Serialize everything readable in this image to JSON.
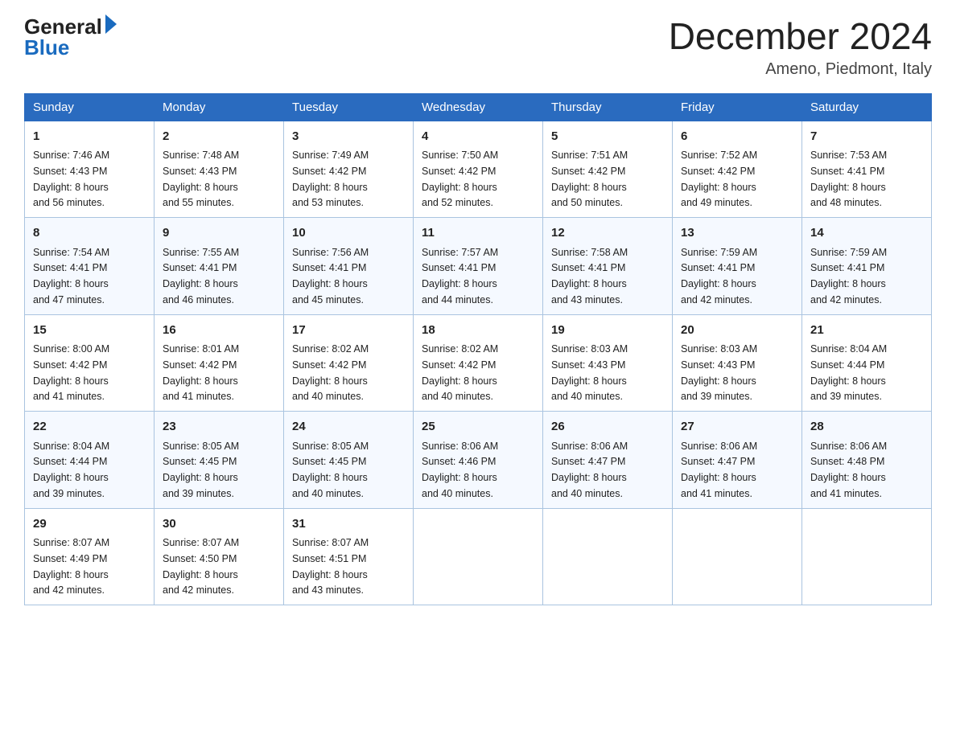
{
  "header": {
    "logo_general": "General",
    "logo_blue": "Blue",
    "month_year": "December 2024",
    "location": "Ameno, Piedmont, Italy"
  },
  "days_of_week": [
    "Sunday",
    "Monday",
    "Tuesday",
    "Wednesday",
    "Thursday",
    "Friday",
    "Saturday"
  ],
  "weeks": [
    [
      {
        "day": "1",
        "sunrise": "7:46 AM",
        "sunset": "4:43 PM",
        "daylight": "8 hours and 56 minutes."
      },
      {
        "day": "2",
        "sunrise": "7:48 AM",
        "sunset": "4:43 PM",
        "daylight": "8 hours and 55 minutes."
      },
      {
        "day": "3",
        "sunrise": "7:49 AM",
        "sunset": "4:42 PM",
        "daylight": "8 hours and 53 minutes."
      },
      {
        "day": "4",
        "sunrise": "7:50 AM",
        "sunset": "4:42 PM",
        "daylight": "8 hours and 52 minutes."
      },
      {
        "day": "5",
        "sunrise": "7:51 AM",
        "sunset": "4:42 PM",
        "daylight": "8 hours and 50 minutes."
      },
      {
        "day": "6",
        "sunrise": "7:52 AM",
        "sunset": "4:42 PM",
        "daylight": "8 hours and 49 minutes."
      },
      {
        "day": "7",
        "sunrise": "7:53 AM",
        "sunset": "4:41 PM",
        "daylight": "8 hours and 48 minutes."
      }
    ],
    [
      {
        "day": "8",
        "sunrise": "7:54 AM",
        "sunset": "4:41 PM",
        "daylight": "8 hours and 47 minutes."
      },
      {
        "day": "9",
        "sunrise": "7:55 AM",
        "sunset": "4:41 PM",
        "daylight": "8 hours and 46 minutes."
      },
      {
        "day": "10",
        "sunrise": "7:56 AM",
        "sunset": "4:41 PM",
        "daylight": "8 hours and 45 minutes."
      },
      {
        "day": "11",
        "sunrise": "7:57 AM",
        "sunset": "4:41 PM",
        "daylight": "8 hours and 44 minutes."
      },
      {
        "day": "12",
        "sunrise": "7:58 AM",
        "sunset": "4:41 PM",
        "daylight": "8 hours and 43 minutes."
      },
      {
        "day": "13",
        "sunrise": "7:59 AM",
        "sunset": "4:41 PM",
        "daylight": "8 hours and 42 minutes."
      },
      {
        "day": "14",
        "sunrise": "7:59 AM",
        "sunset": "4:41 PM",
        "daylight": "8 hours and 42 minutes."
      }
    ],
    [
      {
        "day": "15",
        "sunrise": "8:00 AM",
        "sunset": "4:42 PM",
        "daylight": "8 hours and 41 minutes."
      },
      {
        "day": "16",
        "sunrise": "8:01 AM",
        "sunset": "4:42 PM",
        "daylight": "8 hours and 41 minutes."
      },
      {
        "day": "17",
        "sunrise": "8:02 AM",
        "sunset": "4:42 PM",
        "daylight": "8 hours and 40 minutes."
      },
      {
        "day": "18",
        "sunrise": "8:02 AM",
        "sunset": "4:42 PM",
        "daylight": "8 hours and 40 minutes."
      },
      {
        "day": "19",
        "sunrise": "8:03 AM",
        "sunset": "4:43 PM",
        "daylight": "8 hours and 40 minutes."
      },
      {
        "day": "20",
        "sunrise": "8:03 AM",
        "sunset": "4:43 PM",
        "daylight": "8 hours and 39 minutes."
      },
      {
        "day": "21",
        "sunrise": "8:04 AM",
        "sunset": "4:44 PM",
        "daylight": "8 hours and 39 minutes."
      }
    ],
    [
      {
        "day": "22",
        "sunrise": "8:04 AM",
        "sunset": "4:44 PM",
        "daylight": "8 hours and 39 minutes."
      },
      {
        "day": "23",
        "sunrise": "8:05 AM",
        "sunset": "4:45 PM",
        "daylight": "8 hours and 39 minutes."
      },
      {
        "day": "24",
        "sunrise": "8:05 AM",
        "sunset": "4:45 PM",
        "daylight": "8 hours and 40 minutes."
      },
      {
        "day": "25",
        "sunrise": "8:06 AM",
        "sunset": "4:46 PM",
        "daylight": "8 hours and 40 minutes."
      },
      {
        "day": "26",
        "sunrise": "8:06 AM",
        "sunset": "4:47 PM",
        "daylight": "8 hours and 40 minutes."
      },
      {
        "day": "27",
        "sunrise": "8:06 AM",
        "sunset": "4:47 PM",
        "daylight": "8 hours and 41 minutes."
      },
      {
        "day": "28",
        "sunrise": "8:06 AM",
        "sunset": "4:48 PM",
        "daylight": "8 hours and 41 minutes."
      }
    ],
    [
      {
        "day": "29",
        "sunrise": "8:07 AM",
        "sunset": "4:49 PM",
        "daylight": "8 hours and 42 minutes."
      },
      {
        "day": "30",
        "sunrise": "8:07 AM",
        "sunset": "4:50 PM",
        "daylight": "8 hours and 42 minutes."
      },
      {
        "day": "31",
        "sunrise": "8:07 AM",
        "sunset": "4:51 PM",
        "daylight": "8 hours and 43 minutes."
      },
      null,
      null,
      null,
      null
    ]
  ],
  "labels": {
    "sunrise": "Sunrise:",
    "sunset": "Sunset:",
    "daylight": "Daylight:"
  }
}
